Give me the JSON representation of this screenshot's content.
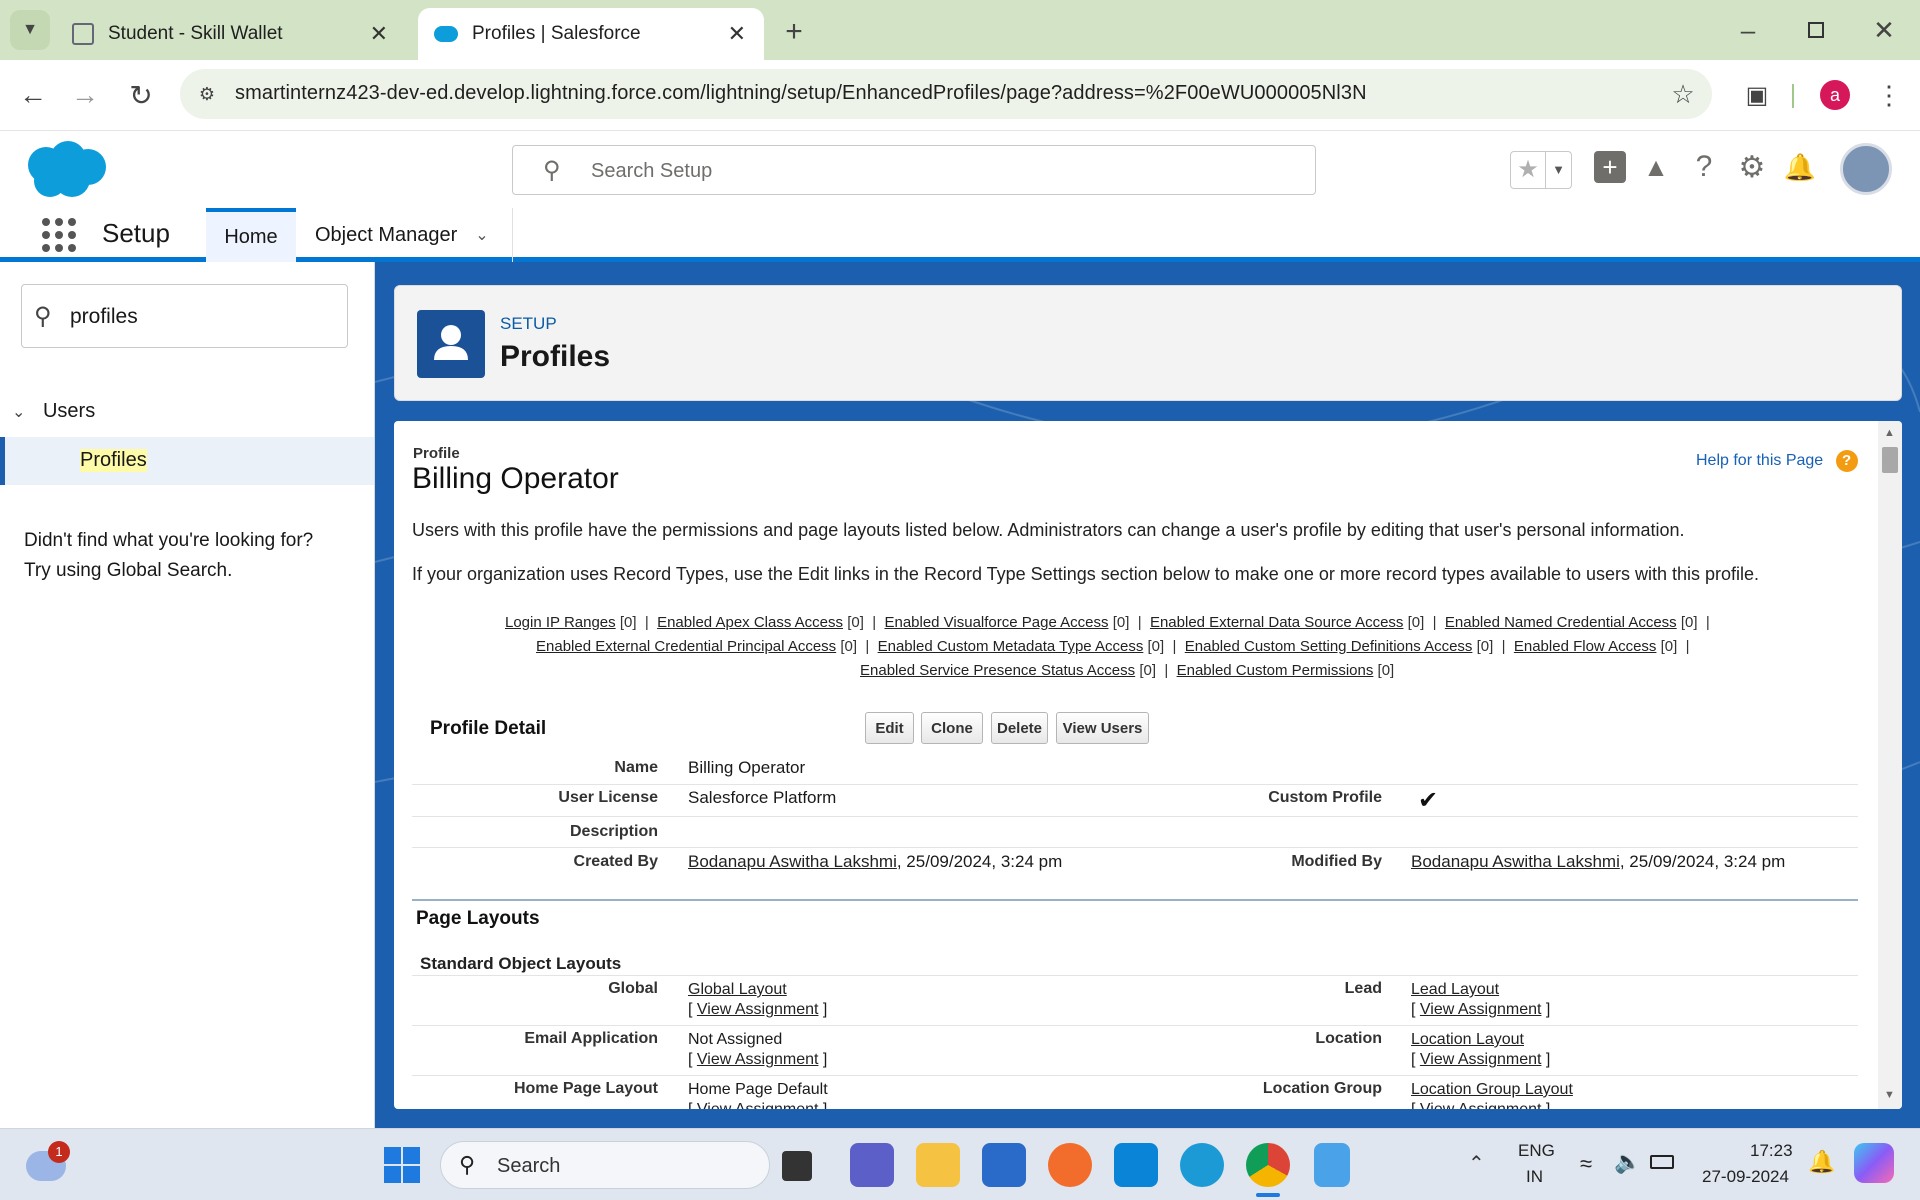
{
  "browser": {
    "tabs": [
      {
        "title": "Student - Skill Wallet",
        "active": false
      },
      {
        "title": "Profiles | Salesforce",
        "active": true
      }
    ],
    "url": "smartinternz423-dev-ed.develop.lightning.force.com/lightning/setup/EnhancedProfiles/page?address=%2F00eWU000005Nl3N",
    "profile_initial": "a"
  },
  "sf_header": {
    "search_placeholder": "Search Setup",
    "app_name": "Setup",
    "nav_tabs": [
      {
        "label": "Home",
        "active": true
      },
      {
        "label": "Object Manager",
        "active": false
      }
    ]
  },
  "sidebar": {
    "quick_find_value": "profiles",
    "tree": {
      "parent": "Users",
      "child": "Profiles"
    },
    "help_line1": "Didn't find what you're looking for?",
    "help_line2": "Try using Global Search."
  },
  "page_header": {
    "eyebrow": "SETUP",
    "title": "Profiles"
  },
  "profile": {
    "type_label": "Profile",
    "name": "Billing Operator",
    "help_link": "Help for this Page",
    "intro1": "Users with this profile have the permissions and page layouts listed below. Administrators can change a user's profile by editing that user's personal information.",
    "intro2": "If your organization uses Record Types, use the Edit links in the Record Type Settings section below to make one or more record types available to users with this profile.",
    "related_links": [
      {
        "label": "Login IP Ranges",
        "count": "[0]"
      },
      {
        "label": "Enabled Apex Class Access",
        "count": "[0]"
      },
      {
        "label": "Enabled Visualforce Page Access",
        "count": "[0]"
      },
      {
        "label": "Enabled External Data Source Access",
        "count": "[0]"
      },
      {
        "label": "Enabled Named Credential Access",
        "count": "[0]"
      },
      {
        "label": "Enabled External Credential Principal Access",
        "count": "[0]"
      },
      {
        "label": "Enabled Custom Metadata Type Access",
        "count": "[0]"
      },
      {
        "label": "Enabled Custom Setting Definitions Access",
        "count": "[0]"
      },
      {
        "label": "Enabled Flow Access",
        "count": "[0]"
      },
      {
        "label": "Enabled Service Presence Status Access",
        "count": "[0]"
      },
      {
        "label": "Enabled Custom Permissions",
        "count": "[0]"
      }
    ],
    "detail_title": "Profile Detail",
    "buttons": [
      "Edit",
      "Clone",
      "Delete",
      "View Users"
    ],
    "fields": {
      "name_label": "Name",
      "name_value": "Billing Operator",
      "license_label": "User License",
      "license_value": "Salesforce Platform",
      "custom_label": "Custom Profile",
      "custom_checked": true,
      "description_label": "Description",
      "description_value": "",
      "created_label": "Created By",
      "created_user": "Bodanapu Aswitha Lakshmi",
      "created_date": ", 25/09/2024, 3:24 pm",
      "modified_label": "Modified By",
      "modified_user": "Bodanapu Aswitha Lakshmi",
      "modified_date": ", 25/09/2024, 3:24 pm"
    },
    "page_layouts_title": "Page Layouts",
    "standard_layouts_title": "Standard Object Layouts",
    "view_assignment": "View Assignment",
    "layouts_left": [
      {
        "object": "Global",
        "layout": "Global Layout",
        "linked": true
      },
      {
        "object": "Email Application",
        "layout": "Not Assigned",
        "linked": false
      },
      {
        "object": "Home Page Layout",
        "layout": "Home Page Default",
        "linked": false
      }
    ],
    "layouts_right": [
      {
        "object": "Lead",
        "layout": "Lead Layout",
        "linked": true
      },
      {
        "object": "Location",
        "layout": "Location Layout",
        "linked": true
      },
      {
        "object": "Location Group",
        "layout": "Location Group Layout",
        "linked": true
      }
    ]
  },
  "taskbar": {
    "search_label": "Search",
    "lang1": "ENG",
    "lang2": "IN",
    "time": "17:23",
    "date": "27-09-2024",
    "weather_badge": "1"
  }
}
